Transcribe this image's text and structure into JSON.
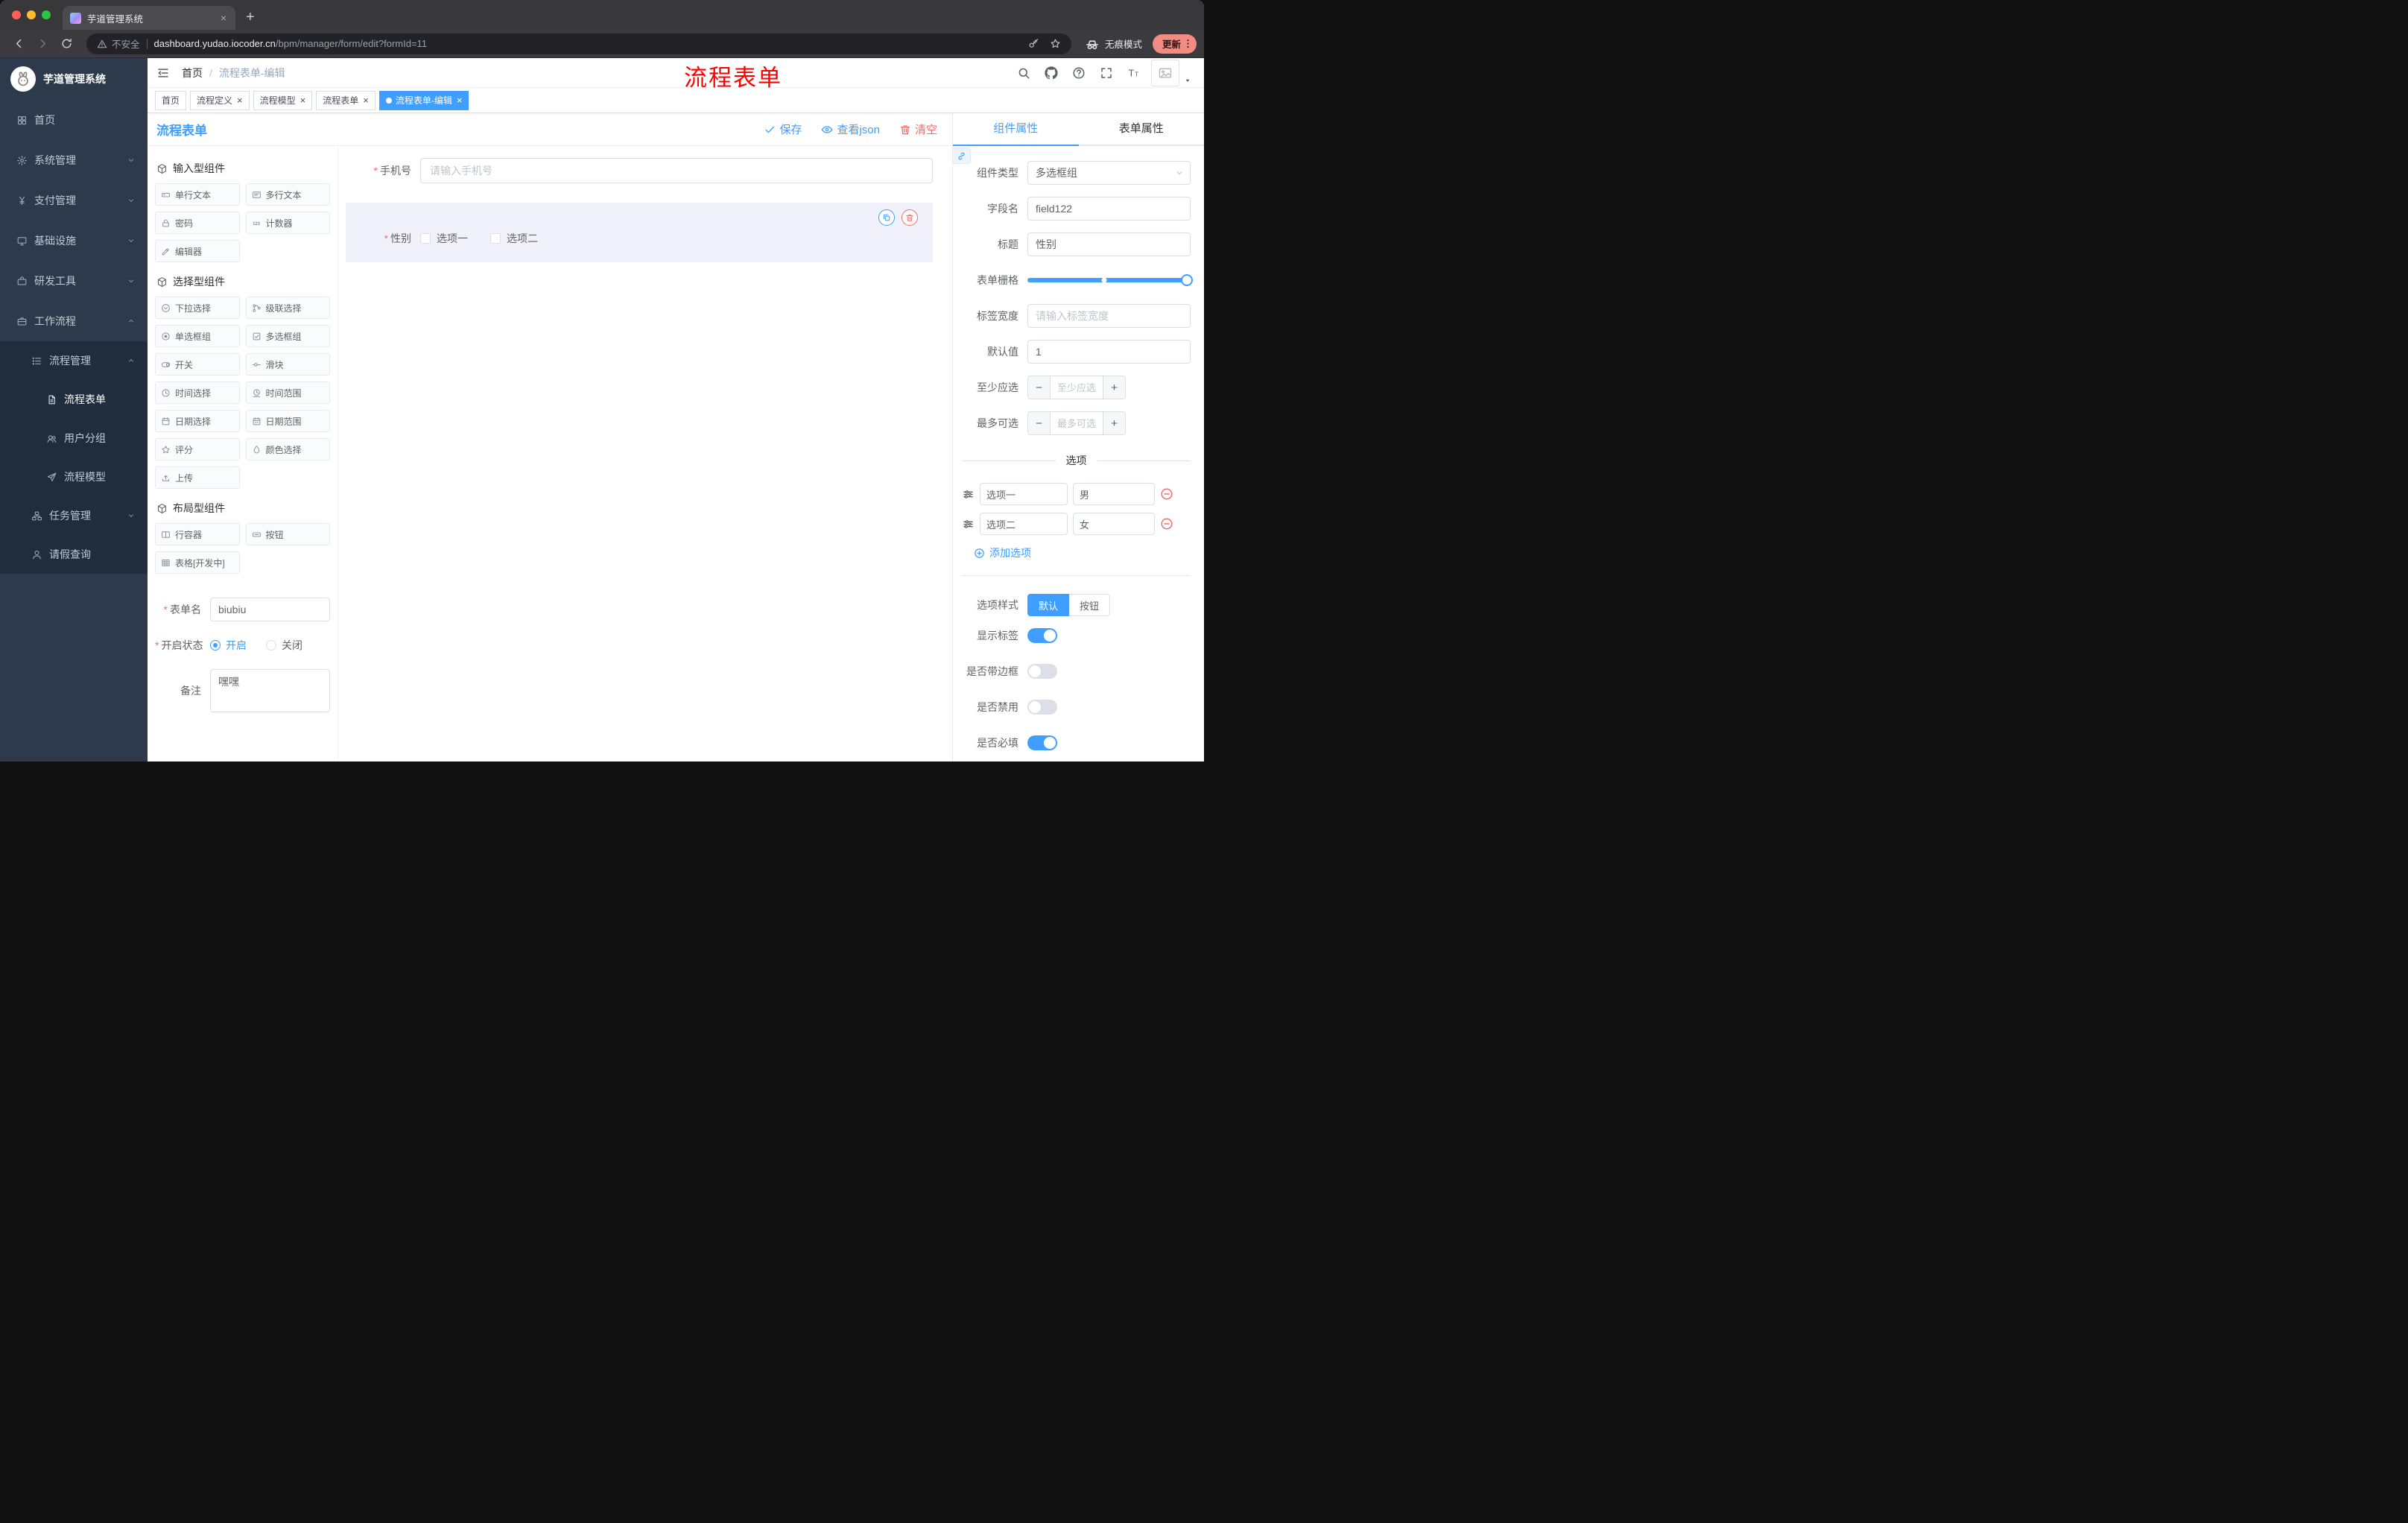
{
  "colors": {
    "accent": "#409eff",
    "danger": "#f56c6c",
    "annotation": "#ff0000",
    "sidebar_bg": "#2d3a4b",
    "submenu_bg": "#1f2d3d",
    "tag_active": "#409eff"
  },
  "glyphs": {
    "required": "*",
    "minus": "−",
    "plus": "+"
  },
  "browser": {
    "tab": {
      "title": "芋道管理系统",
      "close": "×",
      "new_tab": "+"
    },
    "toolbar": {
      "security": "不安全",
      "url_domain": "dashboard.yudao.iocoder.cn",
      "url_path": "/bpm/manager/form/edit?formId=11",
      "incognito": "无痕模式",
      "update": "更新"
    }
  },
  "sidebar": {
    "app_title": "芋道管理系统",
    "items": [
      {
        "label": "首页",
        "icon": "home",
        "level": 1
      },
      {
        "label": "系统管理",
        "icon": "gear",
        "level": 1,
        "chevron": "down"
      },
      {
        "label": "支付管理",
        "icon": "yen",
        "level": 1,
        "chevron": "down"
      },
      {
        "label": "基础设施",
        "icon": "infra",
        "level": 1,
        "chevron": "down"
      },
      {
        "label": "研发工具",
        "icon": "tool",
        "level": 1,
        "chevron": "down"
      },
      {
        "label": "工作流程",
        "icon": "flow",
        "level": 1,
        "chevron": "up"
      },
      {
        "label": "流程管理",
        "icon": "list",
        "level": 2,
        "chevron": "up",
        "sub": true
      },
      {
        "label": "流程表单",
        "icon": "doc",
        "level": 3,
        "sub": true,
        "active": true
      },
      {
        "label": "用户分组",
        "icon": "users",
        "level": 3,
        "sub": true
      },
      {
        "label": "流程模型",
        "icon": "send",
        "level": 3,
        "sub": true
      },
      {
        "label": "任务管理",
        "icon": "tree",
        "level": 2,
        "chevron": "down",
        "sub": true
      },
      {
        "label": "请假查询",
        "icon": "person",
        "level": 2,
        "sub": true
      }
    ]
  },
  "navbar": {
    "breadcrumb": {
      "home": "首页",
      "sep": "/",
      "current": "流程表单-编辑"
    },
    "annotation": "流程表单",
    "icons": [
      {
        "name": "search-icon",
        "icon": "search"
      },
      {
        "name": "github-icon",
        "icon": "github"
      },
      {
        "name": "help-icon",
        "icon": "question"
      },
      {
        "name": "fullscreen-icon",
        "icon": "fullscreen"
      },
      {
        "name": "font-size-icon",
        "icon": "textsize"
      }
    ]
  },
  "tags": [
    {
      "label": "首页"
    },
    {
      "label": "流程定义",
      "close": "×"
    },
    {
      "label": "流程模型",
      "close": "×"
    },
    {
      "label": "流程表单",
      "close": "×"
    },
    {
      "label": "流程表单-编辑",
      "close": "×",
      "active": true
    }
  ],
  "designer": {
    "title": "流程表单",
    "actions": [
      {
        "name": "save-button",
        "label": "保存",
        "icon": "check",
        "color": "blue"
      },
      {
        "name": "view-json-button",
        "label": "查看json",
        "icon": "eye",
        "color": "blue"
      },
      {
        "name": "clear-button",
        "label": "清空",
        "icon": "trash",
        "color": "red"
      }
    ],
    "groups": [
      {
        "title": "输入型组件",
        "items": [
          {
            "label": "单行文本",
            "icon": "comp-input"
          },
          {
            "label": "多行文本",
            "icon": "comp-textarea"
          },
          {
            "label": "密码",
            "icon": "comp-password"
          },
          {
            "label": "计数器",
            "icon": "comp-counter"
          },
          {
            "label": "编辑器",
            "icon": "comp-editor"
          }
        ]
      },
      {
        "title": "选择型组件",
        "items": [
          {
            "label": "下拉选择",
            "icon": "comp-select"
          },
          {
            "label": "级联选择",
            "icon": "comp-cascader"
          },
          {
            "label": "单选框组",
            "icon": "comp-radio"
          },
          {
            "label": "多选框组",
            "icon": "comp-checkbox"
          },
          {
            "label": "开关",
            "icon": "comp-switch"
          },
          {
            "label": "滑块",
            "icon": "comp-slider"
          },
          {
            "label": "时间选择",
            "icon": "comp-time"
          },
          {
            "label": "时间范围",
            "icon": "comp-time-range"
          },
          {
            "label": "日期选择",
            "icon": "comp-date"
          },
          {
            "label": "日期范围",
            "icon": "comp-date-range"
          },
          {
            "label": "评分",
            "icon": "comp-rate"
          },
          {
            "label": "颜色选择",
            "icon": "comp-color"
          },
          {
            "label": "上传",
            "icon": "comp-upload"
          }
        ]
      },
      {
        "title": "布局型组件",
        "items": [
          {
            "label": "行容器",
            "icon": "comp-row"
          },
          {
            "label": "按钮",
            "icon": "comp-button"
          },
          {
            "label": "表格[开发中]",
            "icon": "comp-table"
          }
        ]
      }
    ],
    "meta": {
      "name_label": "表单名",
      "name_value": "biubiu",
      "status_label": "开启状态",
      "status_on": "开启",
      "status_off": "关闭",
      "remark_label": "备注",
      "remark_value": "嘿嘿"
    },
    "canvas": {
      "phone": {
        "label": "手机号",
        "placeholder": "请输入手机号",
        "required": true
      },
      "gender": {
        "label": "性别",
        "required": true,
        "options": [
          "选项一",
          "选项二"
        ]
      }
    }
  },
  "props": {
    "tabs": [
      {
        "label": "组件属性",
        "active": true
      },
      {
        "label": "表单属性"
      }
    ],
    "fields": {
      "component_type": {
        "label": "组件类型",
        "value": "多选框组"
      },
      "field_name": {
        "label": "字段名",
        "value": "field122"
      },
      "title": {
        "label": "标题",
        "value": "性别"
      },
      "grid": {
        "label": "表单栅格"
      },
      "label_width": {
        "label": "标签宽度",
        "placeholder": "请输入标签宽度"
      },
      "default_value": {
        "label": "默认值",
        "value": "1"
      },
      "min_select": {
        "label": "至少应选",
        "placeholder": "至少应选"
      },
      "max_select": {
        "label": "最多可选",
        "placeholder": "最多可选"
      }
    },
    "options": {
      "divider": "选项",
      "rows": [
        {
          "label": "选项一",
          "value": "男"
        },
        {
          "label": "选项二",
          "value": "女"
        }
      ],
      "add": "添加选项"
    },
    "switches": {
      "style": {
        "label": "选项样式",
        "on_btn": "默认",
        "off_btn": "按钮"
      },
      "rows": [
        {
          "label": "显示标签",
          "on": true
        },
        {
          "label": "是否带边框",
          "on": false
        },
        {
          "label": "是否禁用",
          "on": false
        },
        {
          "label": "是否必填",
          "on": true
        }
      ]
    }
  }
}
